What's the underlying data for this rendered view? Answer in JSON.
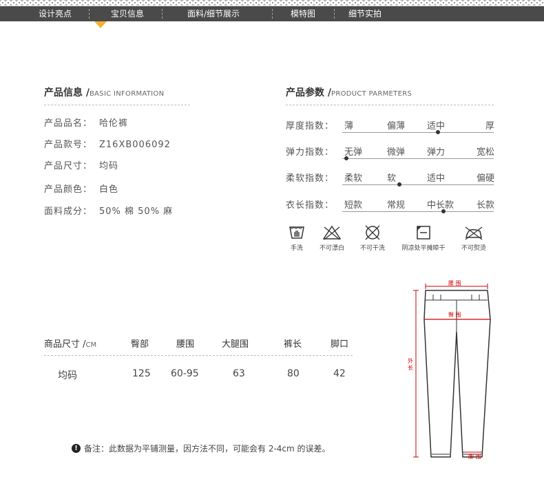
{
  "tabs": [
    {
      "label": "设计亮点"
    },
    {
      "label": "宝贝信息"
    },
    {
      "label": "面料/细节展示"
    },
    {
      "label": "模特图"
    },
    {
      "label": "细节实拍"
    }
  ],
  "product_info": {
    "title": "产品信息 /",
    "title_en": "BASIC INFORMATION",
    "rows": [
      {
        "label": "产品品名：",
        "value": "哈伦裤"
      },
      {
        "label": "产品款号：",
        "value": "Z16XB006092"
      },
      {
        "label": "产品尺寸：",
        "value": "均码"
      },
      {
        "label": "产品颜色：",
        "value": "白色"
      },
      {
        "label": "面料成分：",
        "value": "50% 棉 50% 麻"
      }
    ]
  },
  "product_params": {
    "title": "产品参数 /",
    "title_en": "PRODUCT PARMETERS",
    "rows": [
      {
        "label": "厚度指数：",
        "options": [
          "薄",
          "偏薄",
          "适中",
          "厚"
        ],
        "selected_index": 2
      },
      {
        "label": "弹力指数：",
        "options": [
          "无弹",
          "微弹",
          "弹力",
          "宽松"
        ],
        "selected_index": 0
      },
      {
        "label": "柔软指数：",
        "options": [
          "柔软",
          "软",
          "适中",
          "偏硬"
        ],
        "selected_index": 1
      },
      {
        "label": "衣长指数：",
        "options": [
          "短款",
          "常规",
          "中长款",
          "长款"
        ],
        "selected_index": 2
      }
    ]
  },
  "care": [
    {
      "icon": "hand-wash-icon",
      "label": "手洗"
    },
    {
      "icon": "no-bleach-icon",
      "label": "不可漂白"
    },
    {
      "icon": "no-dry-clean-icon",
      "label": "不可干洗"
    },
    {
      "icon": "dry-flat-shade-icon",
      "label": "阴凉处平摊晾干"
    },
    {
      "icon": "no-iron-icon",
      "label": "不可熨烫"
    }
  ],
  "size_table": {
    "title": "商品尺寸 /",
    "unit": "CM",
    "headers": [
      "臀部",
      "腰围",
      "大腿围",
      "裤长",
      "脚口"
    ],
    "rows": [
      {
        "size": "均码",
        "values": [
          "125",
          "60-95",
          "63",
          "80",
          "42"
        ]
      }
    ]
  },
  "note": "备注：此数据为平铺测量，因方法不同，可能会有 2-4cm 的误差。",
  "diagram": {
    "waist": "腰 围",
    "hip": "臀 围",
    "length": "外长",
    "hem": "脚 围"
  },
  "colors": {
    "accent": "#f5b033",
    "tabbar": "#4a4a4a",
    "measure": "#cc0000"
  }
}
